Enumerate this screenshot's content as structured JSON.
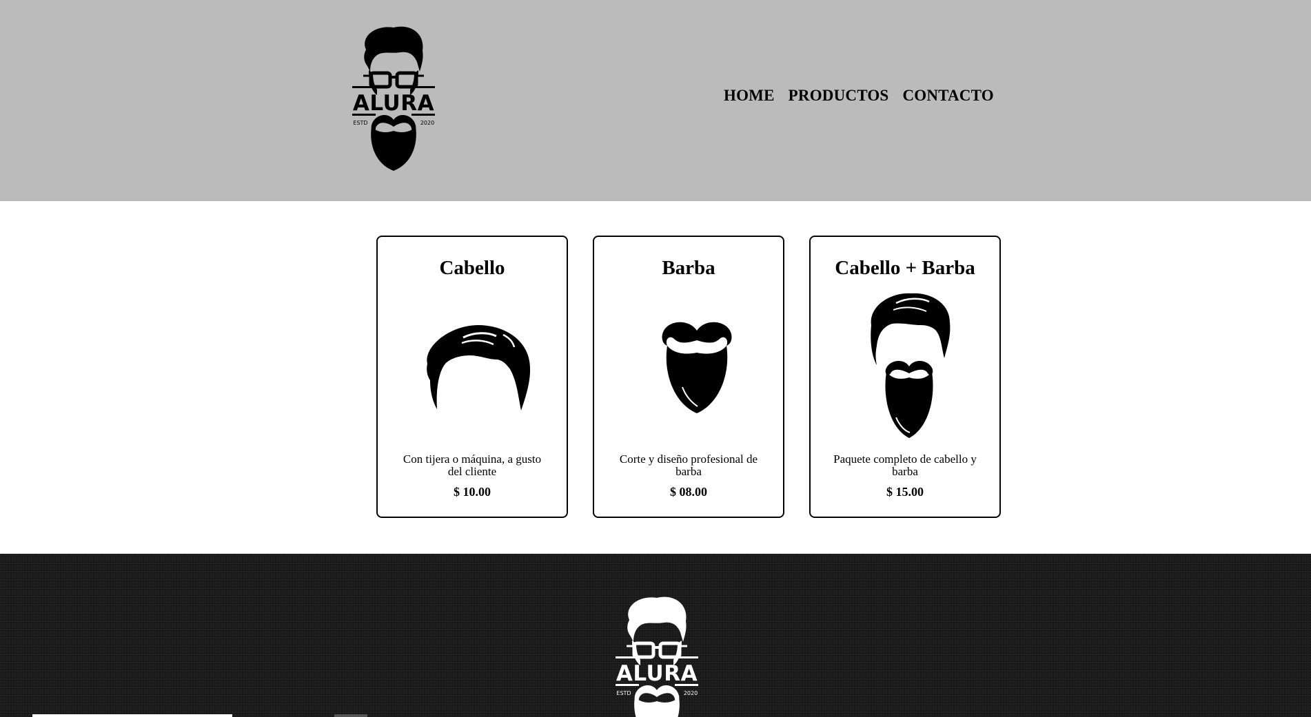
{
  "header": {
    "logo": {
      "brand": "ALURA",
      "left_text": "ESTD",
      "right_text": "2020"
    },
    "nav": [
      "HOME",
      "PRODUCTOS",
      "CONTACTO"
    ]
  },
  "products": [
    {
      "title": "Cabello",
      "image": "hair-icon",
      "description": "Con tijera o máquina, a gusto del cliente",
      "price": "$ 10.00"
    },
    {
      "title": "Barba",
      "image": "beard-icon",
      "description": "Corte y diseño profesional de barba",
      "price": "$ 08.00"
    },
    {
      "title": "Cabello + Barba",
      "image": "hair-and-beard-icon",
      "description": "Paquete completo de cabello y barba",
      "price": "$ 15.00"
    }
  ],
  "footer": {
    "logo": {
      "brand": "ALURA",
      "left_text": "ESTD",
      "right_text": "2020"
    }
  },
  "colors": {
    "header_bg": "#bbbbbb",
    "footer_bg": "#1d1d1d",
    "text": "#000000"
  }
}
